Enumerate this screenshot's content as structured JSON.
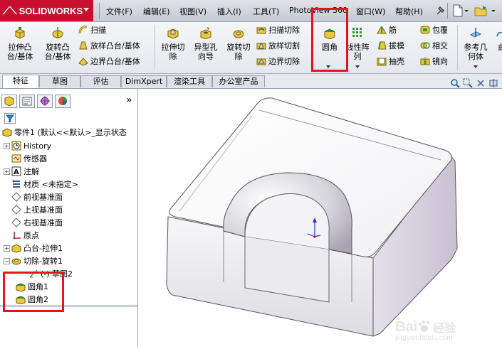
{
  "app": {
    "brand": "SOLIDWORKS",
    "brand_color": "#c8102e"
  },
  "menu": {
    "items": [
      "文件(F)",
      "编辑(E)",
      "视图(V)",
      "插入(I)",
      "工具(T)",
      "PhotoView 360",
      "窗口(W)",
      "帮助(H)"
    ]
  },
  "ribbon": {
    "extrude_boss": "拉伸凸\n台/基体",
    "revolve_boss": "旋转凸\n台/基体",
    "sweep": "扫描",
    "loft_boss": "放样凸台/基体",
    "boundary_boss": "边界凸台/基体",
    "extrude_cut": "拉伸切\n除",
    "hole_wizard": "异型孔\n向导",
    "revolve_cut": "旋转切\n除",
    "sweep_cut": "扫描切除",
    "loft_cut": "放样切割",
    "boundary_cut": "边界切除",
    "fillet": "圆角",
    "linear_pattern": "线性阵\n列",
    "rib": "筋",
    "draft": "拔模",
    "shell": "抽壳",
    "wrap": "包覆",
    "intersect": "相交",
    "mirror": "镜向",
    "ref_geometry": "参考几\n何体",
    "curves": "曲"
  },
  "tabs": [
    "特征",
    "草图",
    "评估",
    "DimXpert",
    "渲染工具",
    "办公室产品"
  ],
  "tree": {
    "root": "零件1 (默认<<默认>_显示状态",
    "history": "History",
    "sensors": "传感器",
    "annotations": "注解",
    "material": "材质 <未指定>",
    "front_plane": "前视基准面",
    "top_plane": "上视基准面",
    "right_plane": "右视基准面",
    "origin": "原点",
    "boss_extrude": "凸台-拉伸1",
    "cut_revolve": "切除-旋转1",
    "sketch2": "(-) 草图2",
    "fillet1": "圆角1",
    "fillet2": "圆角2"
  },
  "watermark": {
    "brand": "Bai",
    "brand2": "经验",
    "url": "jingyan.baidu.com"
  },
  "highlight_color": "#e5141b"
}
